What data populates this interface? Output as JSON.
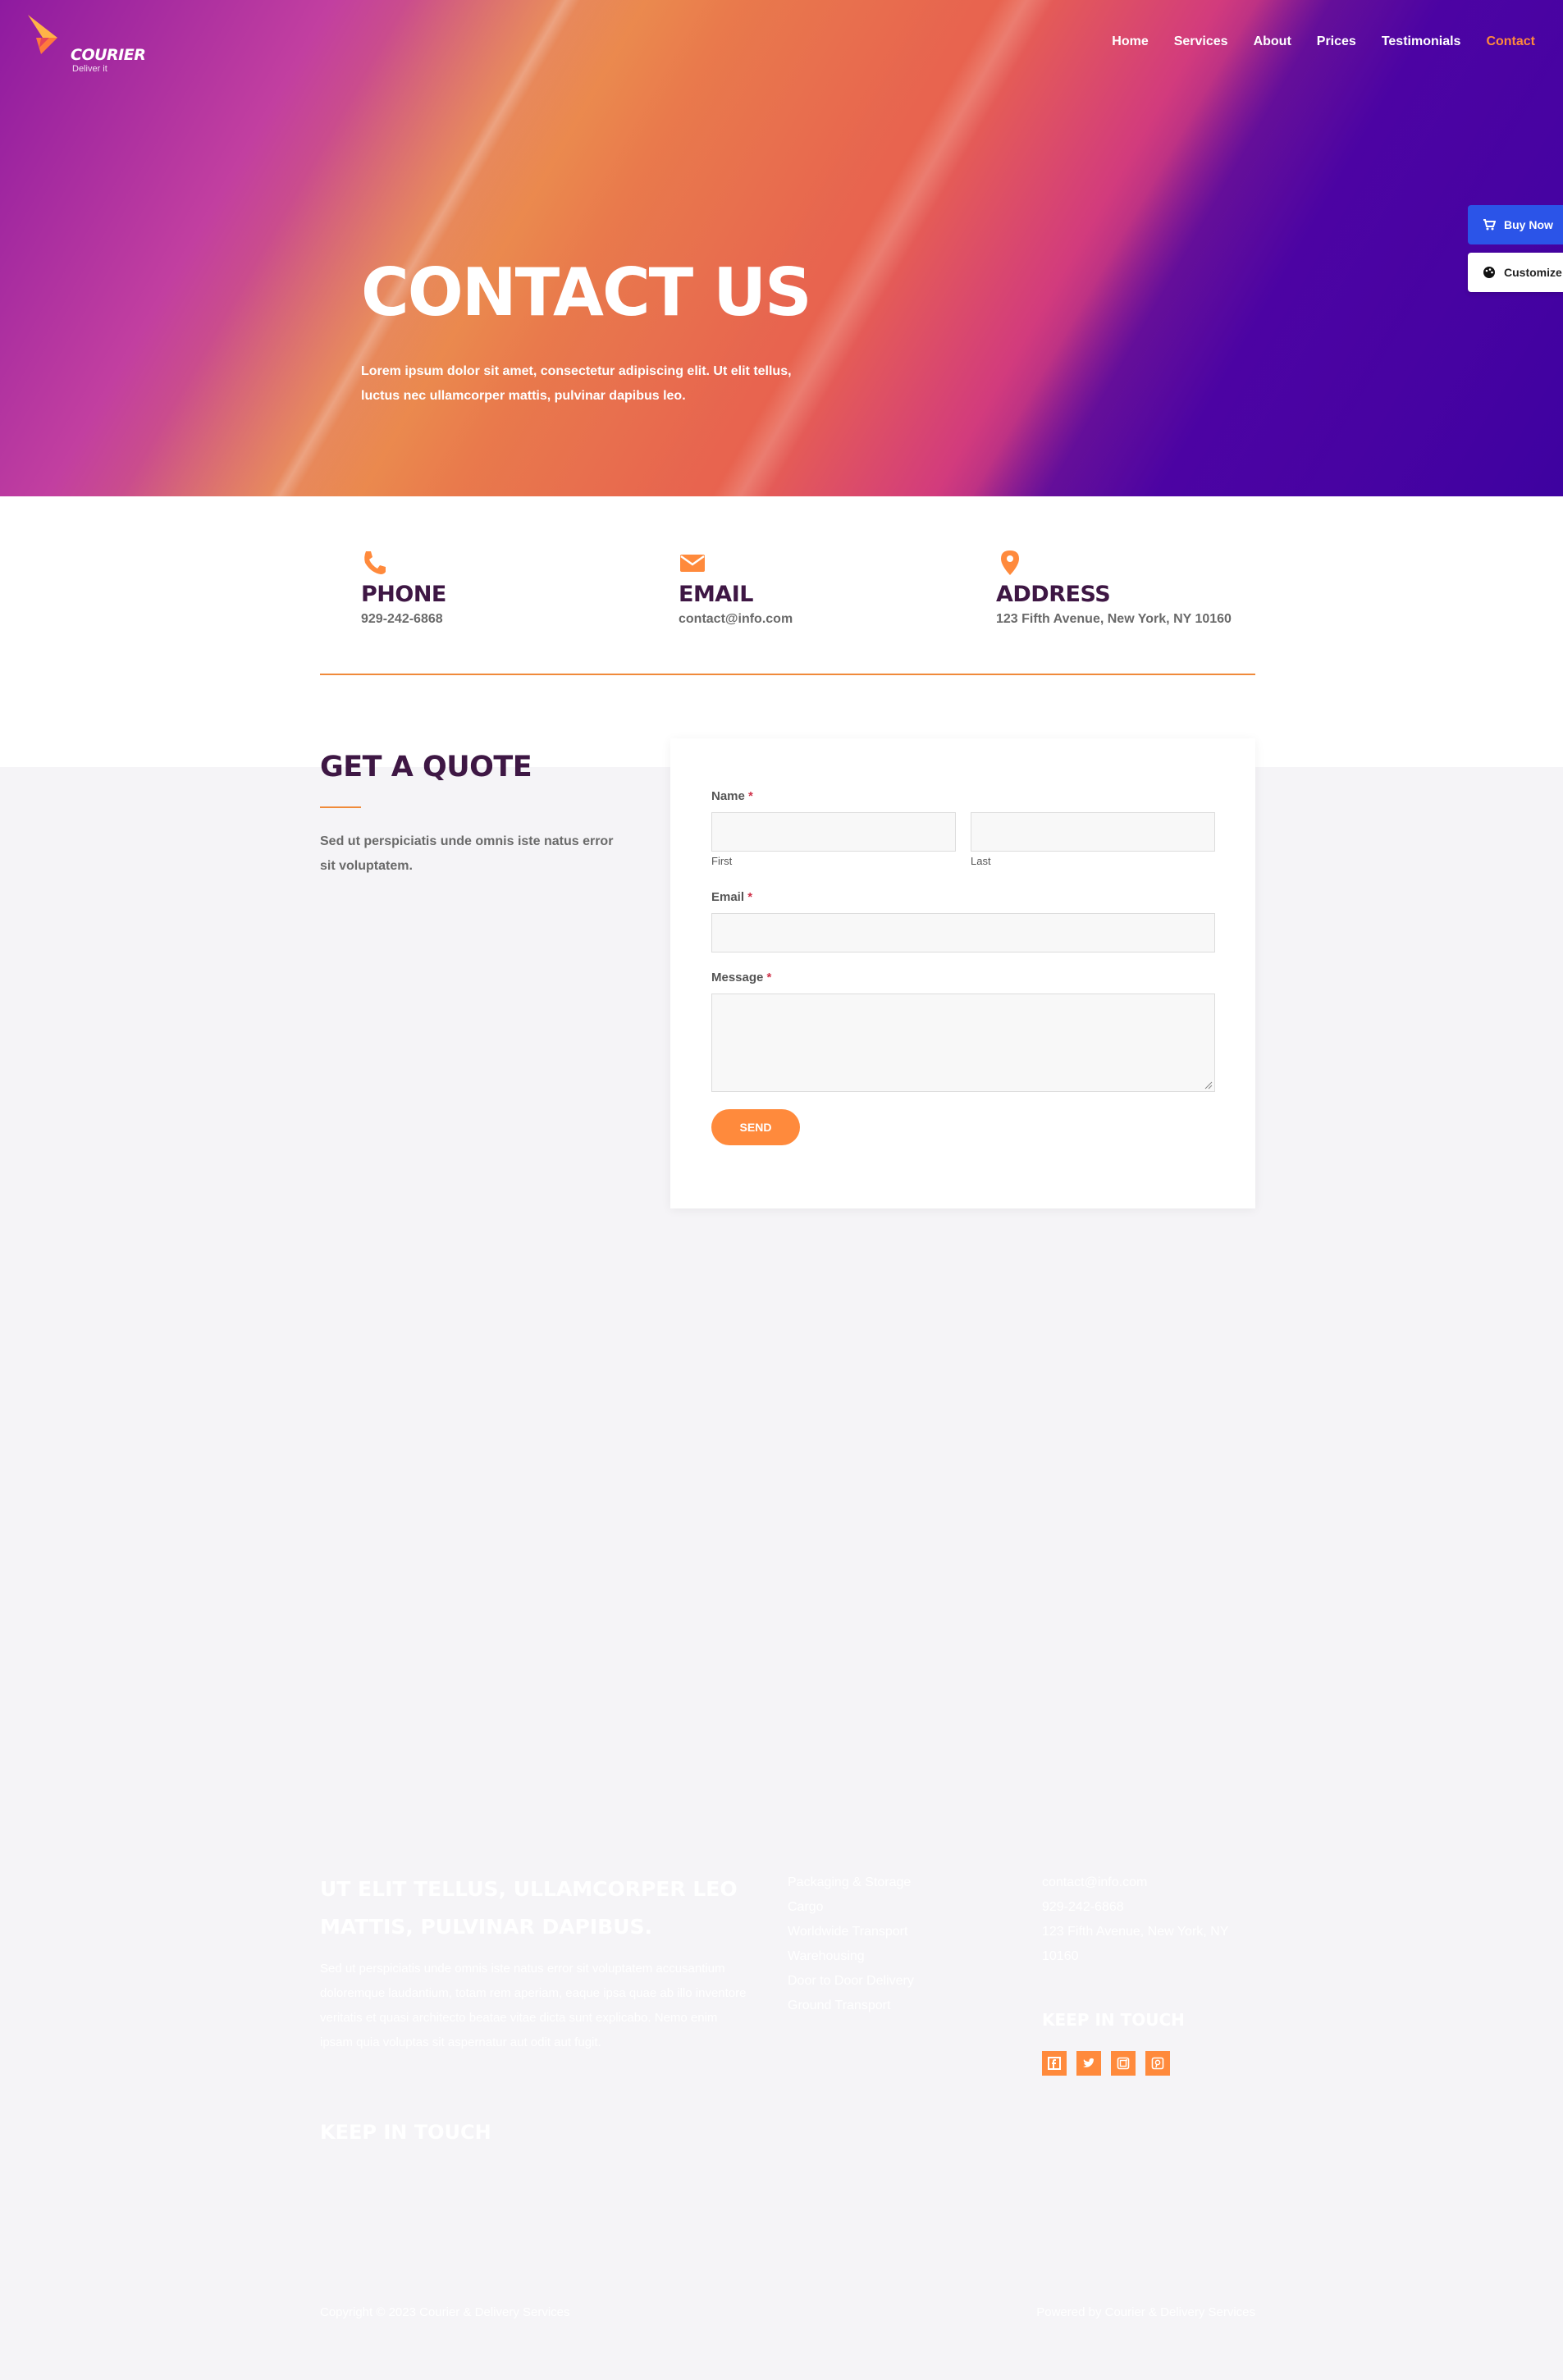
{
  "brand": {
    "name": "COURIER",
    "tagline": "Deliver it"
  },
  "nav": {
    "items": [
      "Home",
      "Services",
      "About",
      "Prices",
      "Testimonials",
      "Contact"
    ],
    "active": "Contact"
  },
  "hero": {
    "title": "CONTACT US",
    "lead": "Lorem ipsum dolor sit amet, consectetur adipiscing elit. Ut elit tellus, luctus nec ullamcorper mattis, pulvinar dapibus leo."
  },
  "side_buttons": {
    "buy": "Buy Now",
    "customize": "Customize"
  },
  "contact": {
    "phone": {
      "title": "PHONE",
      "value": "929-242-6868"
    },
    "email": {
      "title": "EMAIL",
      "value": "contact@info.com"
    },
    "address": {
      "title": "ADDRESS",
      "value": "123 Fifth Avenue, New York, NY 10160"
    }
  },
  "quote": {
    "title": "GET A QUOTE",
    "text": "Sed ut perspiciatis unde omnis iste natus error sit voluptatem."
  },
  "form": {
    "name_label": "Name",
    "email_label": "Email",
    "message_label": "Message",
    "required_mark": "*",
    "first_sublabel": "First",
    "last_sublabel": "Last",
    "send_label": "SEND",
    "first_value": "",
    "last_value": "",
    "email_value": "",
    "message_value": ""
  },
  "footer": {
    "title": "UT ELIT TELLUS, ULLAMCORPER LEO MATTIS, PULVINAR DAPIBUS.",
    "text": "Sed ut perspiciatis unde omnis iste natus error sit voluptatem accusantium doloremque laudantium, totam rem aperiam, eaque ipsa quae ab illo inventore veritatis et quasi architecto beatae vitae dicta sunt explicabo. Nemo enim ipsam quia voluptas sit aspernatur aut odit aut fugit.",
    "keep_in_touch_left": "KEEP IN TOUCH",
    "services": [
      "Packaging & Storage",
      "Cargo",
      "Worldwide Transport",
      "Warehousing",
      "Door to Door Delivery",
      "Ground Transport"
    ],
    "email": "contact@info.com",
    "phone": "929-242-6868",
    "address": "123 Fifth Avenue, New York, NY 10160",
    "keep_in_touch_right": "KEEP IN TOUCH",
    "social_icons": [
      "facebook-icon",
      "twitter-icon",
      "instagram-icon",
      "pinterest-icon"
    ],
    "copyright": "Copyright © 2023 Courier & Delivery Services",
    "powered": "Powered by Courier & Delivery Services"
  },
  "colors": {
    "accent": "#ff8a3c",
    "heading": "#3e1744",
    "buy_button": "#2b54e8",
    "background": "#f5f4f7"
  }
}
